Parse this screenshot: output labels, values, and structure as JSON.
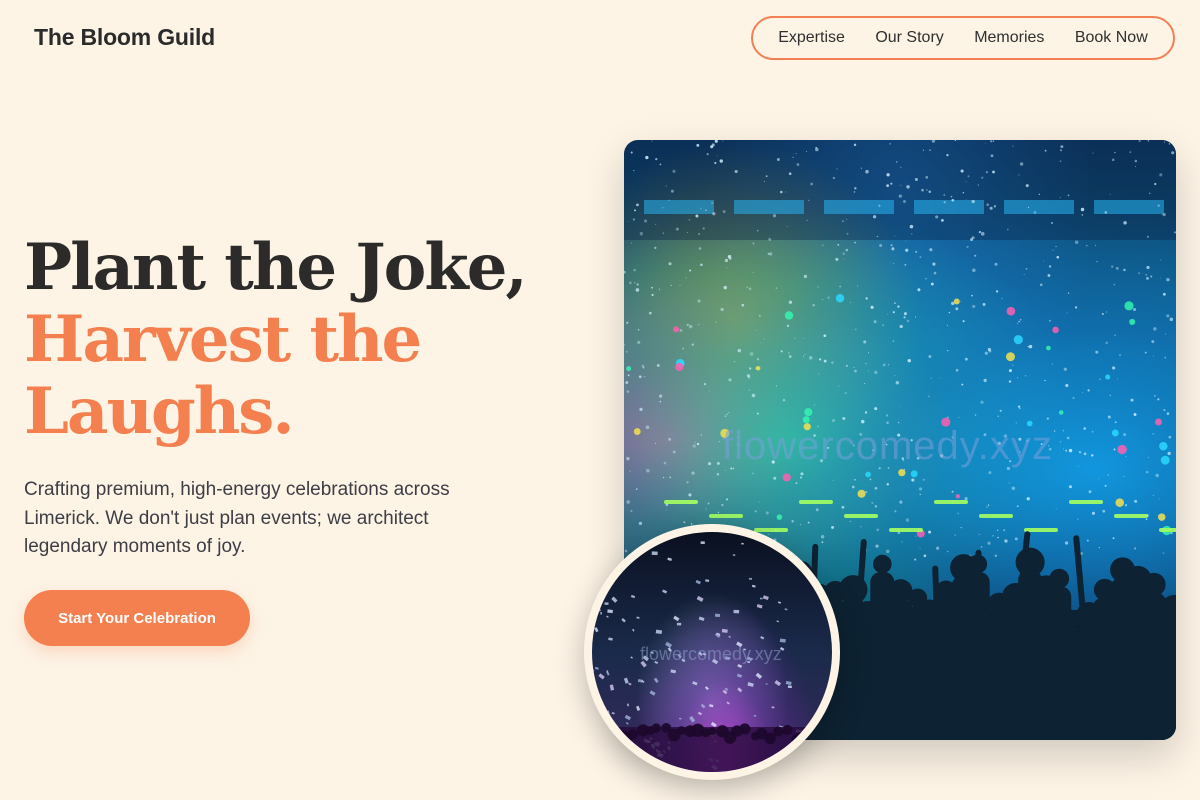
{
  "header": {
    "brand": "The Bloom Guild",
    "nav": [
      {
        "label": "Expertise"
      },
      {
        "label": "Our Story"
      },
      {
        "label": "Memories"
      },
      {
        "label": "Book Now"
      }
    ]
  },
  "hero": {
    "headline_line1": "Plant the Joke,",
    "headline_line2": "Harvest the",
    "headline_line3": "Laughs.",
    "subtext": "Crafting premium, high-energy celebrations across Limerick. We don't just plan events; we architect legendary moments of joy.",
    "cta_label": "Start Your Celebration"
  },
  "images": {
    "main_photo_watermark": "flowercomedy.xyz",
    "circle_photo_watermark": "flowercomedy.xyz"
  },
  "colors": {
    "background": "#fdf4e6",
    "accent": "#f47f4f",
    "text_dark": "#2c2b29"
  }
}
